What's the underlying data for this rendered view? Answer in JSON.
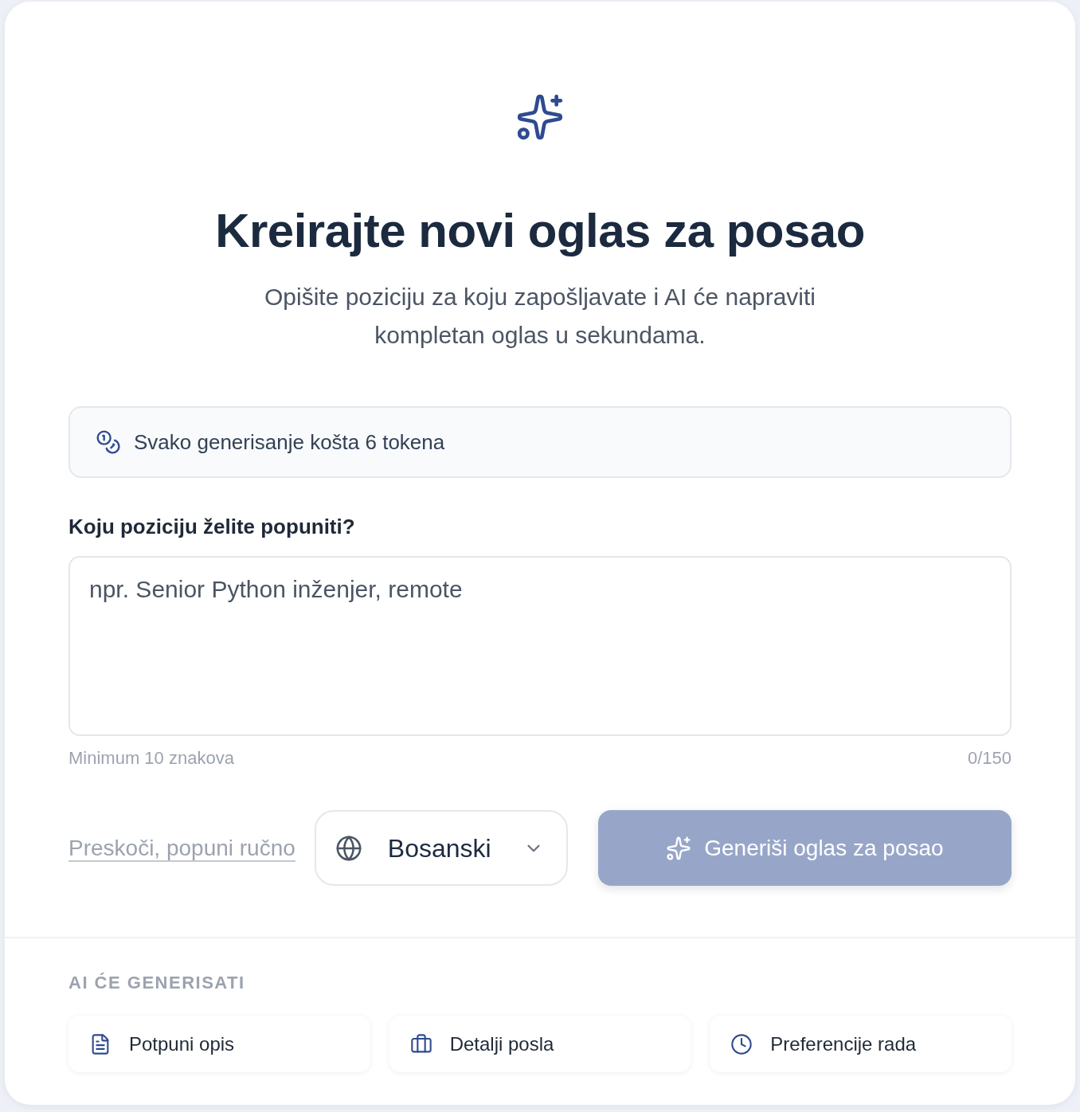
{
  "header": {
    "title": "Kreirajte novi oglas za posao",
    "subtitle": "Opišite poziciju za koju zapošljavate i AI će napraviti kompletan oglas u sekundama."
  },
  "token_notice": {
    "text": "Svako generisanje košta 6 tokena"
  },
  "position_field": {
    "label": "Koju poziciju želite popuniti?",
    "placeholder": "npr. Senior Python inženjer, remote",
    "hint": "Minimum 10 znakova",
    "counter": "0/150"
  },
  "actions": {
    "skip_link": "Preskoči, popuni ručno",
    "language_select": {
      "value": "Bosanski"
    },
    "generate_button": {
      "label": "Generiši oglas za posao",
      "disabled": true
    }
  },
  "features": {
    "heading": "AI ĆE GENERISATI",
    "items": [
      {
        "label": "Potpuni opis",
        "kind": "document"
      },
      {
        "label": "Detalji posla",
        "kind": "briefcase"
      },
      {
        "label": "Preferencije rada",
        "kind": "clock"
      }
    ]
  }
}
